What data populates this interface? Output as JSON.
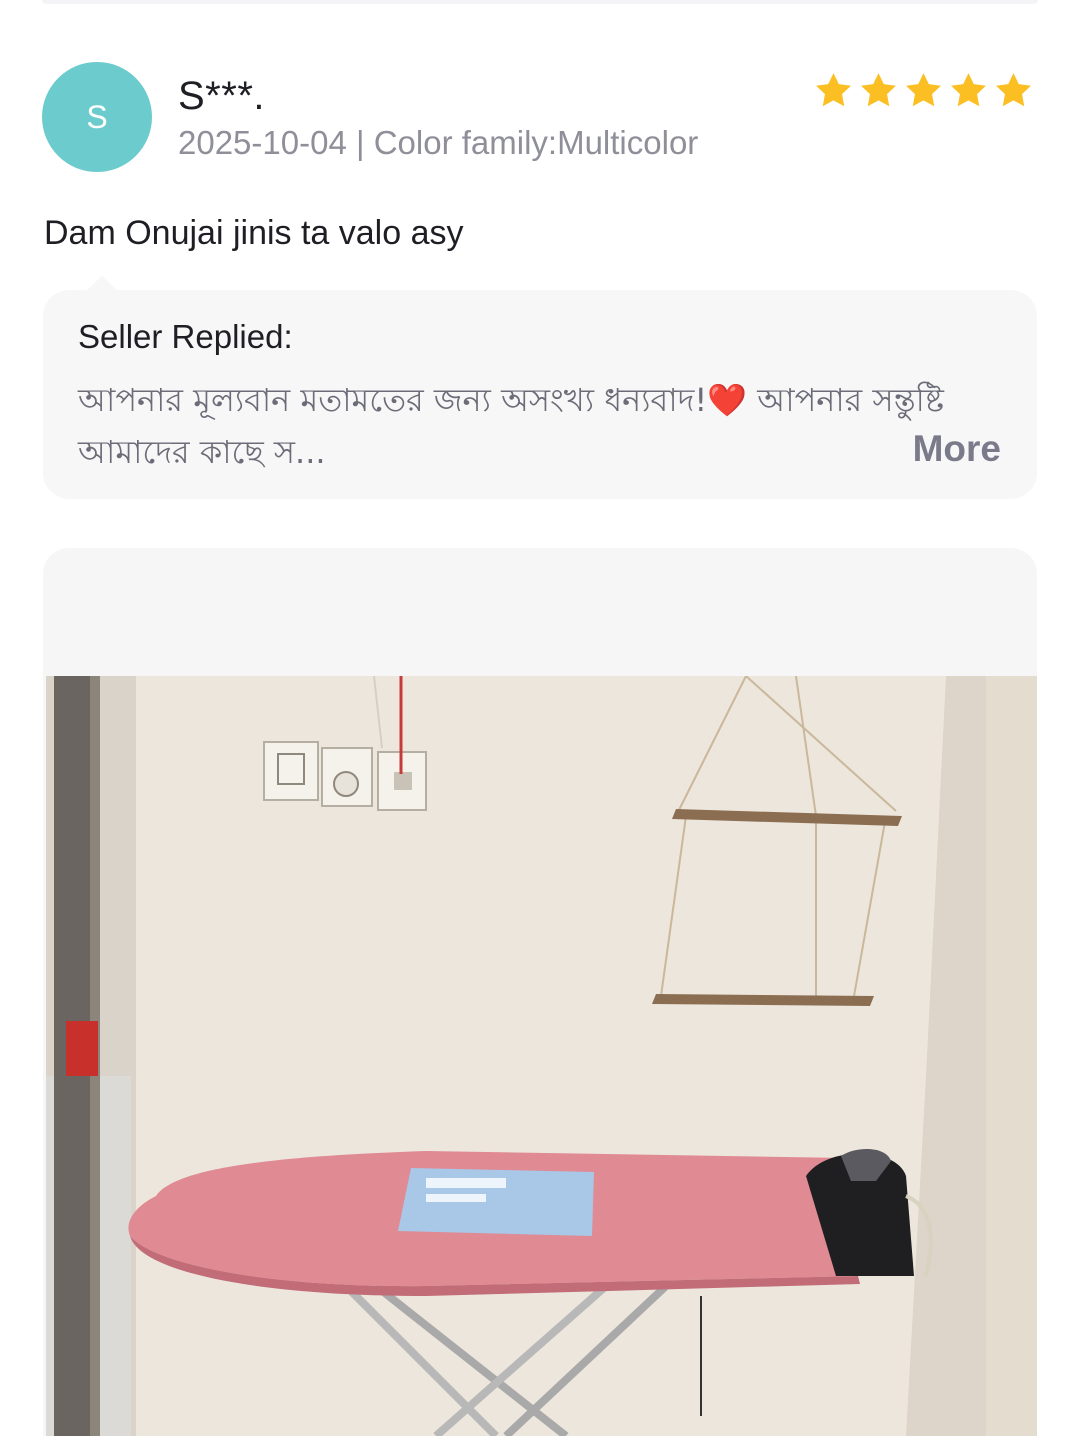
{
  "review": {
    "avatar_initial": "S",
    "reviewer_name": "S***.",
    "meta": "2025-10-04 | Color family:Multicolor",
    "rating": 5,
    "star_color": "#fbbf24",
    "text": "Dam Onujai jinis ta valo asy",
    "seller_reply": {
      "title": "Seller Replied:",
      "text": "আপনার মূল্যবান মতামতের জন্য অসংখ্য ধন্যবাদ!❤️ আপনার সন্তুষ্টি আমাদের কাছে স...",
      "more_label": "More"
    },
    "media": {
      "description_icon": "photo-icon"
    }
  }
}
